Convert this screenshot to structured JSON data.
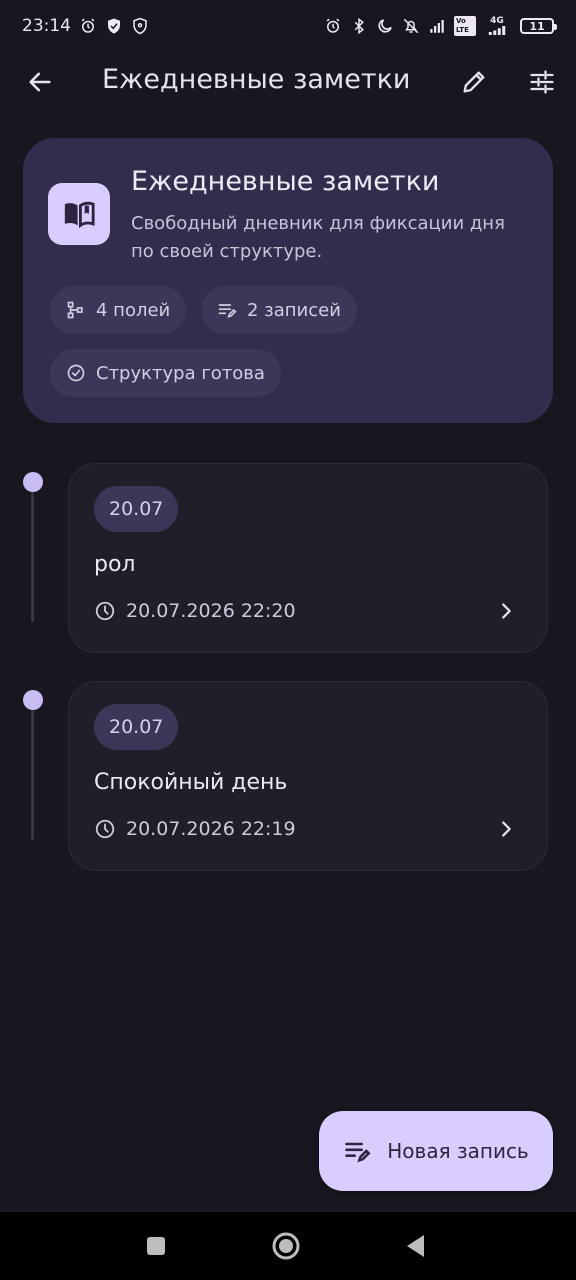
{
  "status_bar": {
    "time": "23:14",
    "left_icons": [
      "alarm-icon",
      "shield-icon",
      "vpn-shield-icon"
    ],
    "right_icons": [
      "alarm-icon",
      "bluetooth-icon",
      "moon-icon",
      "muted-icon",
      "signal-icon",
      "volte-icon",
      "4g-signal-icon"
    ],
    "volte_label": "Vo LTE",
    "network_label": "4G",
    "battery": "11"
  },
  "app_bar": {
    "title": "Ежедневные заметки",
    "back_icon": "arrow-back-icon",
    "edit_icon": "pencil-icon",
    "settings_icon": "tune-icon"
  },
  "header_card": {
    "icon": "book-icon",
    "title": "Ежедневные заметки",
    "description": "Свободный дневник для фиксации дня по своей структуре.",
    "chips": [
      {
        "icon": "fields-tree-icon",
        "label": "4 полей"
      },
      {
        "icon": "notes-edit-icon",
        "label": "2 записей"
      },
      {
        "icon": "check-circle-icon",
        "label": "Структура готова"
      }
    ]
  },
  "entries": [
    {
      "date_badge": "20.07",
      "title": "рол",
      "timestamp": "20.07.2026 22:20"
    },
    {
      "date_badge": "20.07",
      "title": "Спокойный день",
      "timestamp": "20.07.2026 22:19"
    }
  ],
  "fab": {
    "icon": "notes-edit-icon",
    "label": "Новая запись"
  },
  "colors": {
    "background": "#19161F",
    "header_card": "#332C4D",
    "accent": "#D9CCFF",
    "timeline_dot": "#C9BCF5",
    "entry_card": "#211D29",
    "chip": "#3D3659"
  }
}
